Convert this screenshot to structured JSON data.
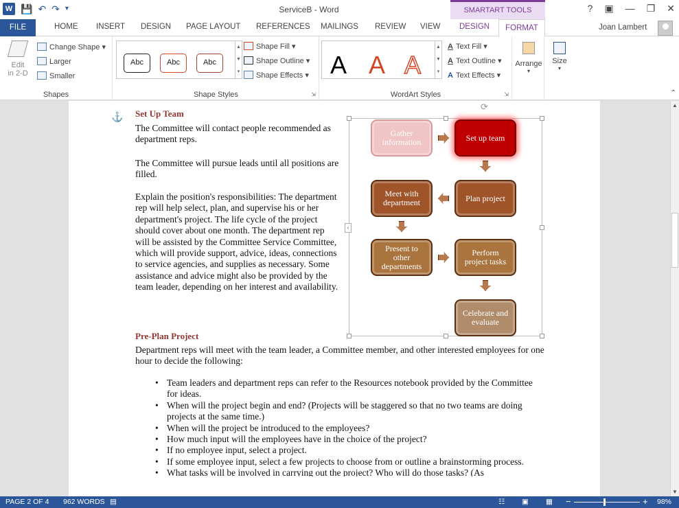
{
  "window": {
    "title": "ServiceB - Word",
    "contextual_tab_group": "SMARTART TOOLS",
    "controls": [
      "?",
      "ribbon-display",
      "minimize",
      "restore",
      "close"
    ]
  },
  "tabs": {
    "file": "FILE",
    "items": [
      "HOME",
      "INSERT",
      "DESIGN",
      "PAGE LAYOUT",
      "REFERENCES",
      "MAILINGS",
      "REVIEW",
      "VIEW"
    ],
    "smartart_design": "DESIGN",
    "smartart_format": "FORMAT",
    "user": "Joan Lambert"
  },
  "ribbon": {
    "shapes": {
      "edit_2d": "Edit\nin 2-D",
      "change_shape": "Change Shape",
      "larger": "Larger",
      "smaller": "Smaller",
      "label": "Shapes"
    },
    "shape_styles": {
      "swatches": [
        "Abc",
        "Abc",
        "Abc"
      ],
      "fill": "Shape Fill",
      "outline": "Shape Outline",
      "effects": "Shape Effects",
      "label": "Shape Styles"
    },
    "wordart": {
      "letters": [
        "A",
        "A",
        "A"
      ],
      "text_fill": "Text Fill",
      "text_outline": "Text Outline",
      "text_effects": "Text Effects",
      "label": "WordArt Styles"
    },
    "arrange": "Arrange",
    "size": "Size"
  },
  "document": {
    "heading1": "Set Up Team",
    "p1": "The Committee will contact people recommended as department reps.",
    "p2": "The Committee will pursue leads until all positions are filled.",
    "p3": "Explain the position's responsibilities: The department rep will help select, plan, and supervise his or her department's project. The life cycle of the project should cover about one month. The department rep will be assisted by the Committee Service Committee, which will provide support, advice, ideas, connections to service agencies, and supplies as necessary. Some assistance and advice might also be provided by the team leader, depending on her interest and availability.",
    "heading2": "Pre-Plan Project",
    "p4": "Department reps will meet with the team leader, a Committee member, and other interested employees for one hour to decide the following:",
    "bullets": [
      "Team leaders and department reps can refer to the Resources notebook provided by the Committee for ideas.",
      "When will the project begin and end? (Projects will be staggered so that no two teams are doing projects at the same time.)",
      "When will the project be introduced to the employees?",
      "How much input will the employees have in the choice of the project?",
      "If no employee input, select a project.",
      "If some employee input, select a few projects to choose from or outline a brainstorming process.",
      "What tasks will be involved in carrying out the project? Who will do those tasks? (As"
    ]
  },
  "smartart": {
    "nodes": {
      "gather": "Gather information",
      "setup": "Set up team",
      "plan": "Plan project",
      "meet": "Meet with department",
      "present": "Present to other departments",
      "perform": "Perform project tasks",
      "celebrate": "Celebrate and evaluate"
    }
  },
  "statusbar": {
    "page": "PAGE 2 OF 4",
    "words": "962 WORDS",
    "zoom": "98%",
    "zoom_fraction": 0.45
  }
}
